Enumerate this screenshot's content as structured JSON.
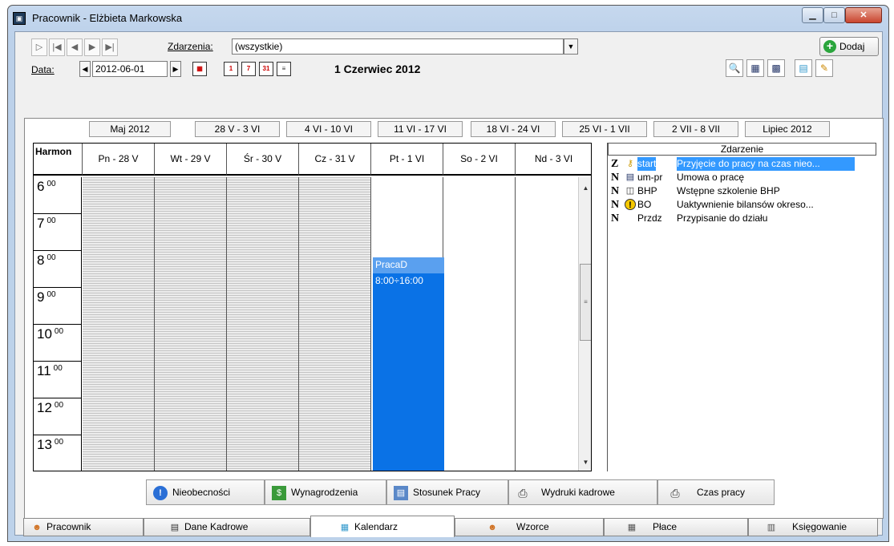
{
  "window": {
    "title": "Pracownik - Elżbieta Markowska"
  },
  "nav_toolbar": {
    "events_label": "Zdarzenia:",
    "events_value": "(wszystkie)",
    "add_label": "Dodaj",
    "date_label": "Data:",
    "date_value": "2012-06-01",
    "date_display": "1 Czerwiec 2012"
  },
  "weeks": [
    "Maj 2012",
    "28 V - 3 VI",
    "4 VI - 10 VI",
    "11 VI - 17 VI",
    "18 VI - 24 VI",
    "25 VI - 1 VII",
    "2 VII - 8 VII",
    "Lipiec 2012"
  ],
  "calendar": {
    "harmon_label": "Harmon",
    "days": [
      "Pn - 28 V",
      "Wt - 29 V",
      "Śr - 30 V",
      "Cz - 31 V",
      "Pt - 1 VI",
      "So - 2 VI",
      "Nd - 3 VI"
    ],
    "hours": [
      {
        "h": "6",
        "m": "00"
      },
      {
        "h": "7",
        "m": "00"
      },
      {
        "h": "8",
        "m": "00"
      },
      {
        "h": "9",
        "m": "00"
      },
      {
        "h": "10",
        "m": "00"
      },
      {
        "h": "11",
        "m": "00"
      },
      {
        "h": "12",
        "m": "00"
      },
      {
        "h": "13",
        "m": "00"
      }
    ],
    "event": {
      "title": "PracaD",
      "time": "8:00÷16:00"
    }
  },
  "events_list": {
    "header": "Zdarzenie",
    "rows": [
      {
        "code": "Z",
        "icon": "key-icon",
        "symbol": "start",
        "desc": "Przyjęcie do pracy na czas nieo..."
      },
      {
        "code": "N",
        "icon": "document-icon",
        "symbol": "um-pr",
        "desc": "Umowa o pracę"
      },
      {
        "code": "N",
        "icon": "book-icon",
        "symbol": "BHP",
        "desc": "Wstępne szkolenie BHP"
      },
      {
        "code": "N",
        "icon": "warning-icon",
        "symbol": "BO",
        "desc": "Uaktywnienie bilansów okreso..."
      },
      {
        "code": "N",
        "icon": "",
        "symbol": "Przdz",
        "desc": "Przypisanie do działu"
      }
    ]
  },
  "bottom_buttons": [
    "Nieobecności",
    "Wynagrodzenia",
    "Stosunek Pracy",
    "Wydruki kadrowe",
    "Czas pracy"
  ],
  "tabs": [
    "Pracownik",
    "Dane Kadrowe",
    "Kalendarz",
    "Wzorce",
    "Płace",
    "Księgowanie"
  ],
  "colors": {
    "event_block": "#0a72e6",
    "selection": "#3399ff"
  }
}
